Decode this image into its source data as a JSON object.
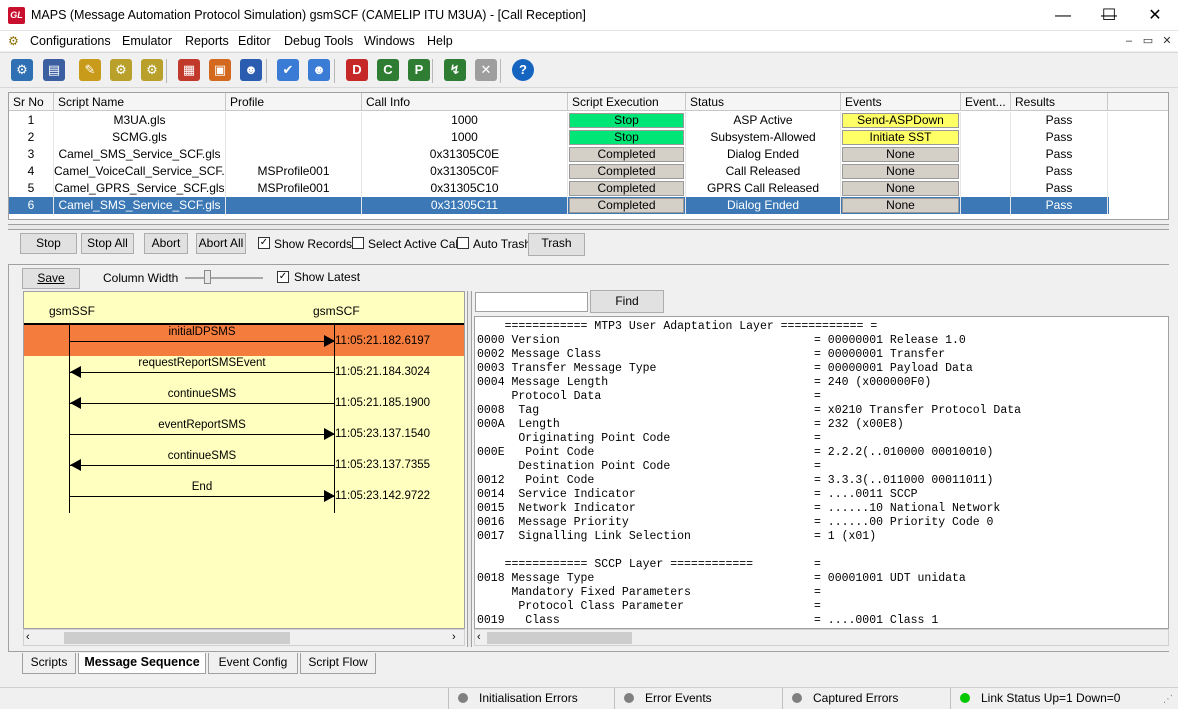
{
  "window": {
    "title": "MAPS (Message Automation Protocol Simulation) gsmSCF (CAMELIP ITU M3UA) - [Call Reception]",
    "logo_text": "GL",
    "minimize": "—",
    "maximize": "☐",
    "close": "✕"
  },
  "menu": {
    "items": [
      "Configurations",
      "Emulator",
      "Reports",
      "Editor",
      "Debug Tools",
      "Windows",
      "Help"
    ],
    "mdi_minimize": "–",
    "mdi_restore": "▭",
    "mdi_close": "✕"
  },
  "toolbar": {
    "buttons": [
      {
        "icon": "gear-icon",
        "color": "#2f6fb3"
      },
      {
        "icon": "notebook-icon",
        "color": "#3b5fa0"
      },
      {
        "icon": "script-edit-icon",
        "color": "#c89b1a"
      },
      {
        "icon": "gears-icon",
        "color": "#b8a02a"
      },
      {
        "icon": "gears-alt-icon",
        "color": "#b8a02a"
      },
      {
        "icon": "blocks-icon",
        "color": "#c0392b"
      },
      {
        "icon": "briefcase-icon",
        "color": "#d2691e"
      },
      {
        "icon": "user-lock-icon",
        "color": "#2a5db0"
      },
      {
        "icon": "pencil-check-icon",
        "color": "#3a7bd5"
      },
      {
        "icon": "user-settings-icon",
        "color": "#3a7bd5"
      },
      {
        "icon": "page-d-icon",
        "color": "#c62828"
      },
      {
        "icon": "page-c-icon",
        "color": "#2e7d32"
      },
      {
        "icon": "page-p-icon",
        "color": "#2e7d32"
      },
      {
        "icon": "call-transfer-icon",
        "color": "#2e7d32"
      },
      {
        "icon": "pin-icon",
        "color": "#9e9e9e"
      },
      {
        "icon": "help-icon",
        "color": "#1565c0"
      }
    ]
  },
  "scripts_table": {
    "headers": [
      "Sr No",
      "Script Name",
      "Profile",
      "Call Info",
      "Script Execution",
      "Status",
      "Events",
      "Event...",
      "Results"
    ],
    "rows": [
      {
        "sr": "1",
        "name": "M3UA.gls",
        "profile": "",
        "call": "1000",
        "exec": "Stop",
        "exec_style": "green",
        "status": "ASP Active",
        "event": "Send-ASPDown",
        "event_style": "yellow",
        "result": "Pass"
      },
      {
        "sr": "2",
        "name": "SCMG.gls",
        "profile": "",
        "call": "1000",
        "exec": "Stop",
        "exec_style": "green",
        "status": "Subsystem-Allowed",
        "event": "Initiate SST",
        "event_style": "yellow",
        "result": "Pass"
      },
      {
        "sr": "3",
        "name": "Camel_SMS_Service_SCF.gls",
        "profile": "",
        "call": "0x31305C0E",
        "exec": "Completed",
        "exec_style": "gray",
        "status": "Dialog Ended",
        "event": "None",
        "event_style": "gray",
        "result": "Pass"
      },
      {
        "sr": "4",
        "name": "Camel_VoiceCall_Service_SCF.gls",
        "profile": "MSProfile001",
        "call": "0x31305C0F",
        "exec": "Completed",
        "exec_style": "gray",
        "status": "Call Released",
        "event": "None",
        "event_style": "gray",
        "result": "Pass"
      },
      {
        "sr": "5",
        "name": "Camel_GPRS_Service_SCF.gls",
        "profile": "MSProfile001",
        "call": "0x31305C10",
        "exec": "Completed",
        "exec_style": "gray",
        "status": "GPRS Call Released",
        "event": "None",
        "event_style": "gray",
        "result": "Pass"
      },
      {
        "sr": "6",
        "name": "Camel_SMS_Service_SCF.gls",
        "profile": "",
        "call": "0x31305C11",
        "exec": "Completed",
        "exec_style": "gray",
        "status": "Dialog Ended",
        "event": "None",
        "event_style": "gray",
        "result": "Pass",
        "selected": true
      }
    ]
  },
  "controls": {
    "stop": "Stop",
    "stop_all": "Stop All",
    "abort": "Abort",
    "abort_all": "Abort All",
    "show_records": "Show Records",
    "show_records_checked": true,
    "select_active_call": "Select Active Call",
    "select_active_call_checked": false,
    "auto_trash": "Auto Trash",
    "auto_trash_checked": false,
    "trash": "Trash"
  },
  "sequence_toolbar": {
    "save": "Save",
    "column_width": "Column Width",
    "show_latest": "Show Latest",
    "show_latest_checked": true,
    "slider_value": 0.3
  },
  "sequence": {
    "left_entity": "gsmSSF",
    "right_entity": "gsmSCF",
    "messages": [
      {
        "label": "initialDPSMS",
        "time": "11:05:21.182.6197",
        "dir": "right",
        "highlight": true
      },
      {
        "label": "requestReportSMSEvent",
        "time": "11:05:21.184.3024",
        "dir": "left",
        "highlight": false
      },
      {
        "label": "continueSMS",
        "time": "11:05:21.185.1900",
        "dir": "left",
        "highlight": false
      },
      {
        "label": "eventReportSMS",
        "time": "11:05:23.137.1540",
        "dir": "right",
        "highlight": false
      },
      {
        "label": "continueSMS",
        "time": "11:05:23.137.7355",
        "dir": "left",
        "highlight": false
      },
      {
        "label": "End",
        "time": "11:05:23.142.9722",
        "dir": "right",
        "highlight": false
      }
    ],
    "highlight_color": "#f47c3c"
  },
  "decode": {
    "find_label": "Find",
    "find_value": "",
    "lines": [
      {
        "field": "    ============ MTP3 User Adaptation Layer ============ =",
        "value": ""
      },
      {
        "field": "0000 Version",
        "value": "= 00000001 Release 1.0"
      },
      {
        "field": "0002 Message Class",
        "value": "= 00000001 Transfer"
      },
      {
        "field": "0003 Transfer Message Type",
        "value": "= 00000001 Payload Data"
      },
      {
        "field": "0004 Message Length",
        "value": "= 240 (x000000F0)"
      },
      {
        "field": "     Protocol Data",
        "value": "="
      },
      {
        "field": "0008  Tag",
        "value": "= x0210 Transfer Protocol Data"
      },
      {
        "field": "000A  Length",
        "value": "= 232 (x00E8)"
      },
      {
        "field": "      Originating Point Code",
        "value": "="
      },
      {
        "field": "000E   Point Code",
        "value": "= 2.2.2(..010000 00010010)"
      },
      {
        "field": "      Destination Point Code",
        "value": "="
      },
      {
        "field": "0012   Point Code",
        "value": "= 3.3.3(..011000 00011011)"
      },
      {
        "field": "0014  Service Indicator",
        "value": "= ....0011 SCCP"
      },
      {
        "field": "0015  Network Indicator",
        "value": "= ......10 National Network"
      },
      {
        "field": "0016  Message Priority",
        "value": "= ......00 Priority Code 0"
      },
      {
        "field": "0017  Signalling Link Selection",
        "value": "= 1 (x01)"
      },
      {
        "field": "",
        "value": ""
      },
      {
        "field": "    ============ SCCP Layer ============",
        "value": "="
      },
      {
        "field": "0018 Message Type",
        "value": "= 00001001 UDT unidata"
      },
      {
        "field": "     Mandatory Fixed Parameters",
        "value": "="
      },
      {
        "field": "      Protocol Class Parameter",
        "value": "="
      },
      {
        "field": "0019   Class",
        "value": "= ....0001 Class 1"
      }
    ]
  },
  "tabs": [
    {
      "label": "Scripts",
      "active": false
    },
    {
      "label": "Message Sequence",
      "active": true
    },
    {
      "label": "Event Config",
      "active": false
    },
    {
      "label": "Script Flow",
      "active": false
    }
  ],
  "statusbar": {
    "panels": [
      {
        "label": "Initialisation Errors",
        "led": "#808080"
      },
      {
        "label": "Error Events",
        "led": "#808080"
      },
      {
        "label": "Captured Errors",
        "led": "#808080"
      },
      {
        "label": "Link Status Up=1 Down=0",
        "led": "#00c800"
      }
    ]
  }
}
